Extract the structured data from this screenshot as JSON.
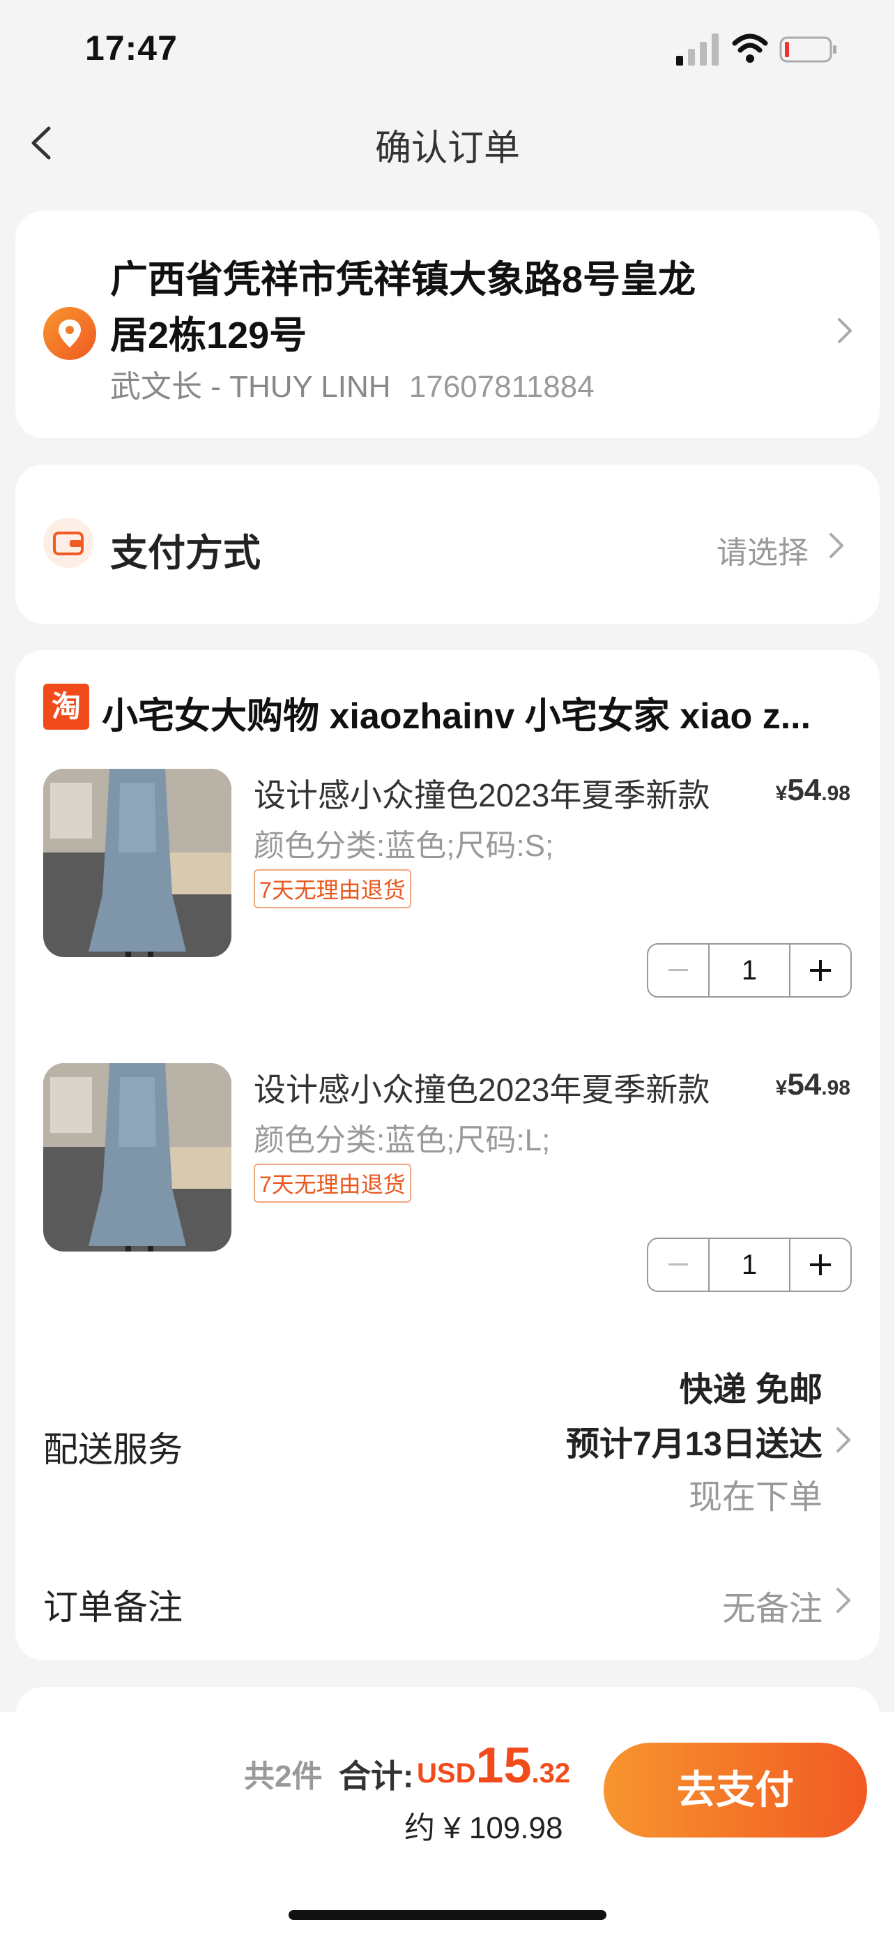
{
  "status_bar": {
    "time": "17:47"
  },
  "nav": {
    "title": "确认订单"
  },
  "address": {
    "line1": "广西省凭祥市凭祥镇大象路8号皇龙",
    "line2": "居2栋129号",
    "contact_name": "武文长 - THUY LINH",
    "phone": "17607811884"
  },
  "payment": {
    "label": "支付方式",
    "value": "请选择"
  },
  "order": {
    "shop_badge": "淘",
    "shop_name": "小宅女大购物 xiaozhainv 小宅女家 xiao z...",
    "items": [
      {
        "title": "设计感小众撞色2023年夏季新款",
        "price_currency": "¥",
        "price_int": "54",
        "price_dec": ".98",
        "sku": "颜色分类:蓝色;尺码:S;",
        "tag": "7天无理由退货",
        "qty": "1"
      },
      {
        "title": "设计感小众撞色2023年夏季新款",
        "price_currency": "¥",
        "price_int": "54",
        "price_dec": ".98",
        "sku": "颜色分类:蓝色;尺码:L;",
        "tag": "7天无理由退货",
        "qty": "1"
      }
    ],
    "delivery": {
      "label": "配送服务",
      "method": "快递 免邮",
      "eta": "预计7月13日送达",
      "note": "现在下单"
    },
    "remark": {
      "label": "订单备注",
      "value": "无备注"
    }
  },
  "footer": {
    "count": "共2件",
    "total_label": "合计:",
    "total_currency": "USD",
    "total_int": "15",
    "total_dec": ".32",
    "approx": "约 ¥ 109.98",
    "pay_button": "去支付"
  },
  "colors": {
    "accent": "#f24b1b",
    "button_gradient_start": "#f7952e",
    "button_gradient_end": "#f15a22"
  }
}
